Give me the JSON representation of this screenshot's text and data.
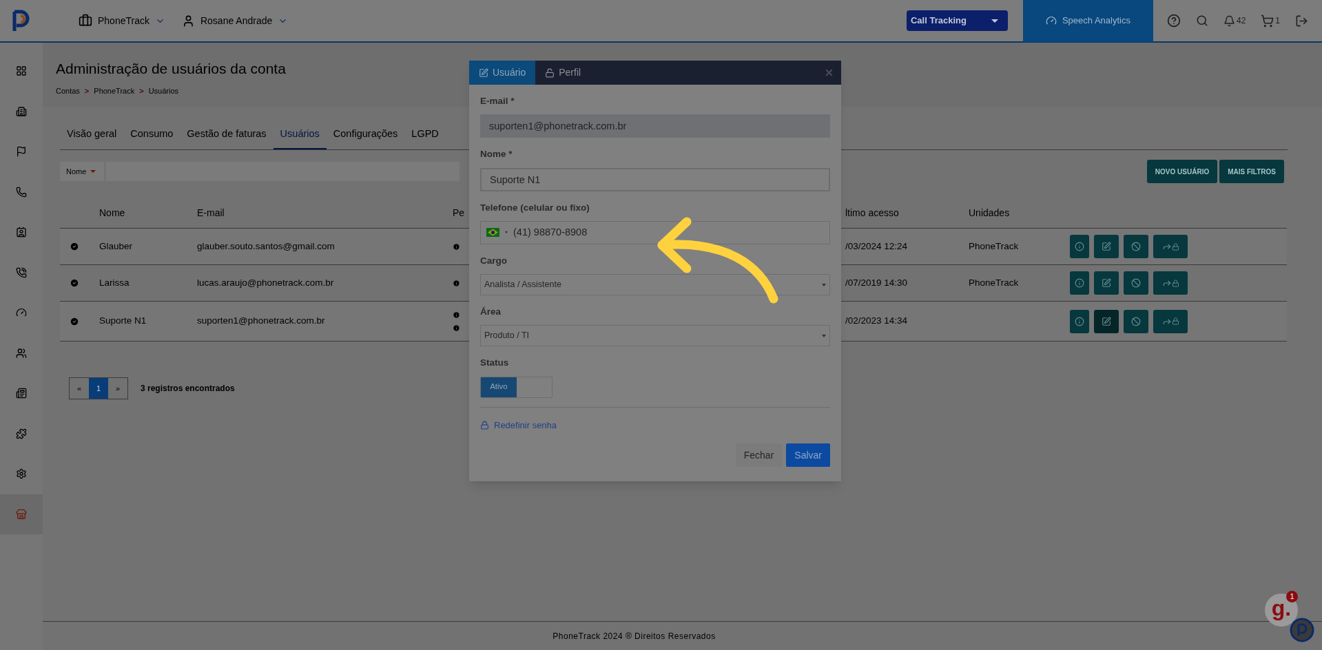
{
  "header": {
    "account_menu": "PhoneTrack",
    "user_menu": "Rosane Andrade",
    "product_select": "Call Tracking",
    "speech_button": "Speech Analytics",
    "notifications": "42",
    "cart": "1"
  },
  "sidebar": {
    "items": [
      {
        "selected": false
      },
      {
        "selected": false
      },
      {
        "selected": false
      },
      {
        "selected": false
      },
      {
        "selected": false
      },
      {
        "selected": false
      },
      {
        "selected": false
      },
      {
        "selected": false
      },
      {
        "selected": false
      },
      {
        "selected": false
      },
      {
        "selected": false
      },
      {
        "selected": true
      }
    ]
  },
  "page": {
    "title": "Administração de usuários da conta",
    "breadcrumb": [
      {
        "label": "Contas"
      },
      {
        "separator": ">",
        "label": "PhoneTrack"
      },
      {
        "separator": ">",
        "label": "Usuários"
      }
    ]
  },
  "tabs": [
    {
      "label": "Visão geral",
      "selected": false
    },
    {
      "label": "Consumo",
      "selected": false
    },
    {
      "label": "Gestão de faturas",
      "selected": false
    },
    {
      "label": "Usuários",
      "selected": true
    },
    {
      "label": "Configurações",
      "selected": false
    },
    {
      "label": "LGPD",
      "selected": false
    }
  ],
  "filter": {
    "field": "Nome",
    "buttons": [
      "NOVO USUÁRIO",
      "MAIS FILTROS"
    ]
  },
  "table": {
    "columns": [
      "Nome",
      "E-mail",
      "Pe",
      "ltimo acesso",
      "Unidades"
    ],
    "rows": [
      {
        "active": true,
        "name": "Glauber",
        "email": "glauber.souto.santos@gmail.com",
        "double_info": false,
        "last_access": "/03/2024 12:24",
        "unit": "PhoneTrack",
        "actions": [
          {
            "kind": "info",
            "highlighted": false
          },
          {
            "kind": "edit",
            "highlighted": false
          },
          {
            "kind": "block",
            "highlighted": false
          },
          {
            "kind": "transfer",
            "highlighted": false
          }
        ]
      },
      {
        "active": true,
        "name": "Larissa",
        "email": "lucas.araujo@phonetrack.com.br",
        "double_info": false,
        "last_access": "/07/2019 14:30",
        "unit": "PhoneTrack",
        "actions": [
          {
            "kind": "info",
            "highlighted": false
          },
          {
            "kind": "edit",
            "highlighted": false
          },
          {
            "kind": "block",
            "highlighted": false
          },
          {
            "kind": "transfer",
            "highlighted": false
          }
        ]
      },
      {
        "active": true,
        "name": "Suporte N1",
        "email": "suporten1@phonetrack.com.br",
        "double_info": true,
        "last_access": "/02/2023 14:34",
        "unit": "",
        "actions": [
          {
            "kind": "info",
            "highlighted": false
          },
          {
            "kind": "edit",
            "highlighted": true
          },
          {
            "kind": "block",
            "highlighted": false
          },
          {
            "kind": "transfer",
            "highlighted": false
          }
        ]
      }
    ]
  },
  "pagination": {
    "prev": "«",
    "pages": [
      {
        "label": "1",
        "selected": true
      }
    ],
    "next": "»",
    "summary": "3 registros encontrados"
  },
  "footer": "PhoneTrack 2024 ® Direitos Reservados",
  "chat_badge": {
    "letter": "g.",
    "count": "1"
  },
  "modal": {
    "tabs": [
      {
        "label": "Usuário",
        "kind": "edit",
        "selected": true
      },
      {
        "label": "Perfil",
        "kind": "unlock",
        "selected": false
      }
    ],
    "fields": [
      {
        "kind": "text",
        "label": "E-mail *",
        "value": "suporten1@phonetrack.com.br",
        "disabled": true
      },
      {
        "kind": "text",
        "label": "Nome *",
        "value": "Suporte N1",
        "disabled": false
      },
      {
        "kind": "phone",
        "label": "Telefone (celular ou fixo)",
        "value": "(41) 98870-8908"
      },
      {
        "kind": "select",
        "label": "Cargo",
        "value": "Analista / Assistente"
      },
      {
        "kind": "select",
        "label": "Área",
        "value": "Produto / TI"
      },
      {
        "kind": "toggle",
        "label": "Status",
        "value": "Ativo",
        "on": true
      }
    ],
    "link": "Redefinir senha",
    "buttons": [
      "Fechar",
      "Salvar"
    ]
  }
}
